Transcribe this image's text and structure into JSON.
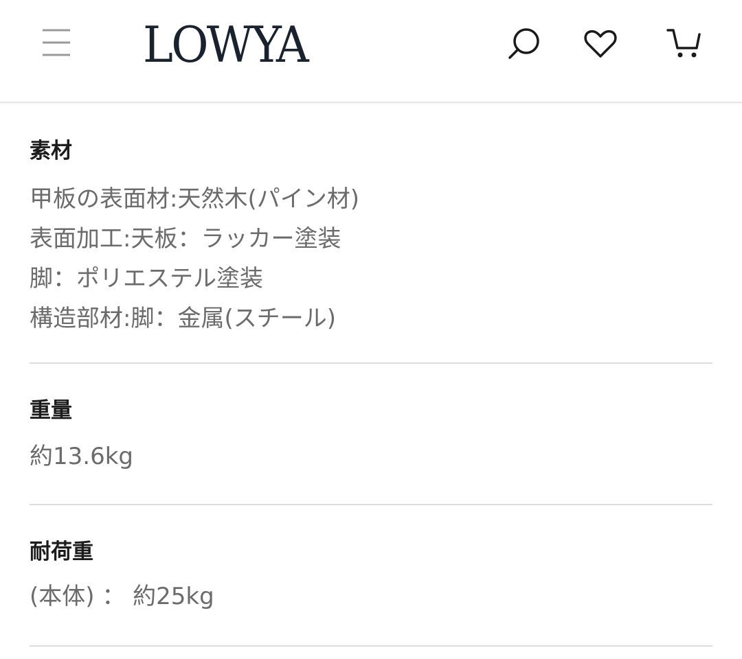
{
  "header": {
    "logo_text": "LOWYA",
    "icons": {
      "menu": "hamburger-menu-icon",
      "search": "search-icon",
      "favorite": "heart-icon",
      "cart": "cart-icon"
    },
    "colors": {
      "logo": "#1a2230",
      "icon": "#1a1a1a",
      "menu_icon": "#9a9a9a"
    }
  },
  "specs": {
    "material": {
      "title": "素材",
      "lines": [
        "甲板の表面材:天然木(パイン材)",
        "表面加工:天板：ラッカー塗装",
        "脚：ポリエステル塗装",
        "構造部材:脚：金属(スチール)"
      ]
    },
    "weight": {
      "title": "重量",
      "lines": [
        "約13.6kg"
      ]
    },
    "load_capacity": {
      "title": "耐荷重",
      "lines": [
        "(本体) ： 約25kg"
      ]
    }
  }
}
